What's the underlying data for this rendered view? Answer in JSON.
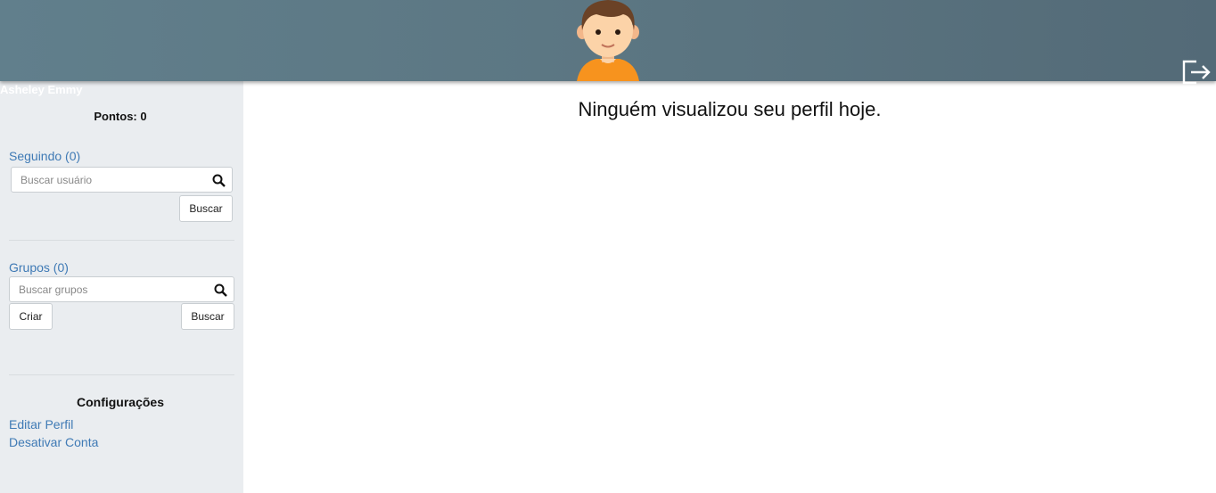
{
  "header": {
    "avatar_icon": "boy-avatar-icon",
    "logout_icon": "logout-icon"
  },
  "user": {
    "name": "Asheley Emmy",
    "points_label": "Pontos: 0"
  },
  "following": {
    "label": "Seguindo (0)",
    "search_placeholder": "Buscar usuário",
    "search_button": "Buscar"
  },
  "groups": {
    "label": "Grupos (0)",
    "search_placeholder": "Buscar grupos",
    "create_button": "Criar",
    "search_button": "Buscar"
  },
  "settings": {
    "title": "Configurações",
    "edit_profile": "Editar Perfil",
    "deactivate_account": "Desativar Conta"
  },
  "main": {
    "message": "Ninguém visualizou seu perfil hoje."
  },
  "colors": {
    "header": "#5b7581",
    "sidebar": "#eaedf0",
    "link": "#3f7ab5",
    "avatar_shirt": "#f7931e",
    "avatar_hair": "#6b4226",
    "avatar_skin": "#fcd3a8"
  }
}
